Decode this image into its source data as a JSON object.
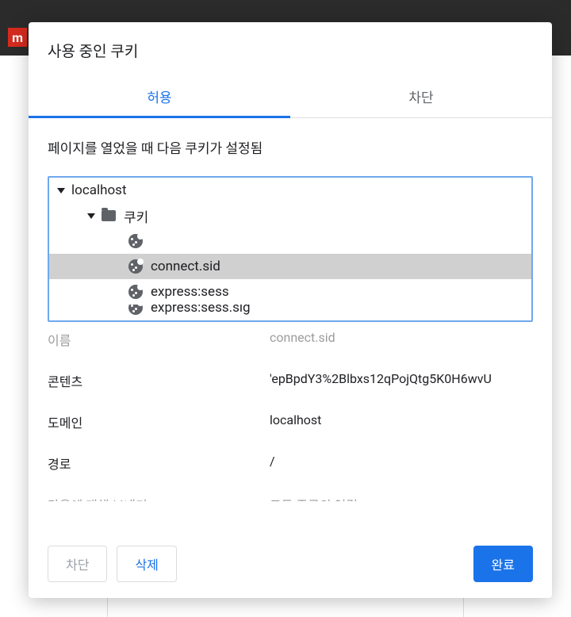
{
  "dialog": {
    "title": "사용 중인 쿠키",
    "tabs": {
      "allow": "허용",
      "block": "차단"
    },
    "description": "페이지를 열었을 때 다음 쿠키가 설정됨",
    "tree": {
      "host": "localhost",
      "folder": "쿠키",
      "cookies": {
        "blank": "",
        "connect_sid": "connect.sid",
        "express_sess": "express:sess",
        "express_sess_sig": "express:sess.sig"
      }
    },
    "details": {
      "name_label": "이름",
      "name_value": "connect.sid",
      "content_label": "콘텐츠",
      "content_value": "'epBpdY3%2Blbxs12qPojQtg5K0H6wvU",
      "domain_label": "도메인",
      "domain_value": "localhost",
      "path_label": "경로",
      "path_value": "/",
      "send_label": "다음에 대해 보내기:",
      "send_value": "모든 종류의 연결"
    },
    "footer": {
      "block": "차단",
      "delete": "삭제",
      "done": "완료"
    }
  },
  "logo": "m"
}
